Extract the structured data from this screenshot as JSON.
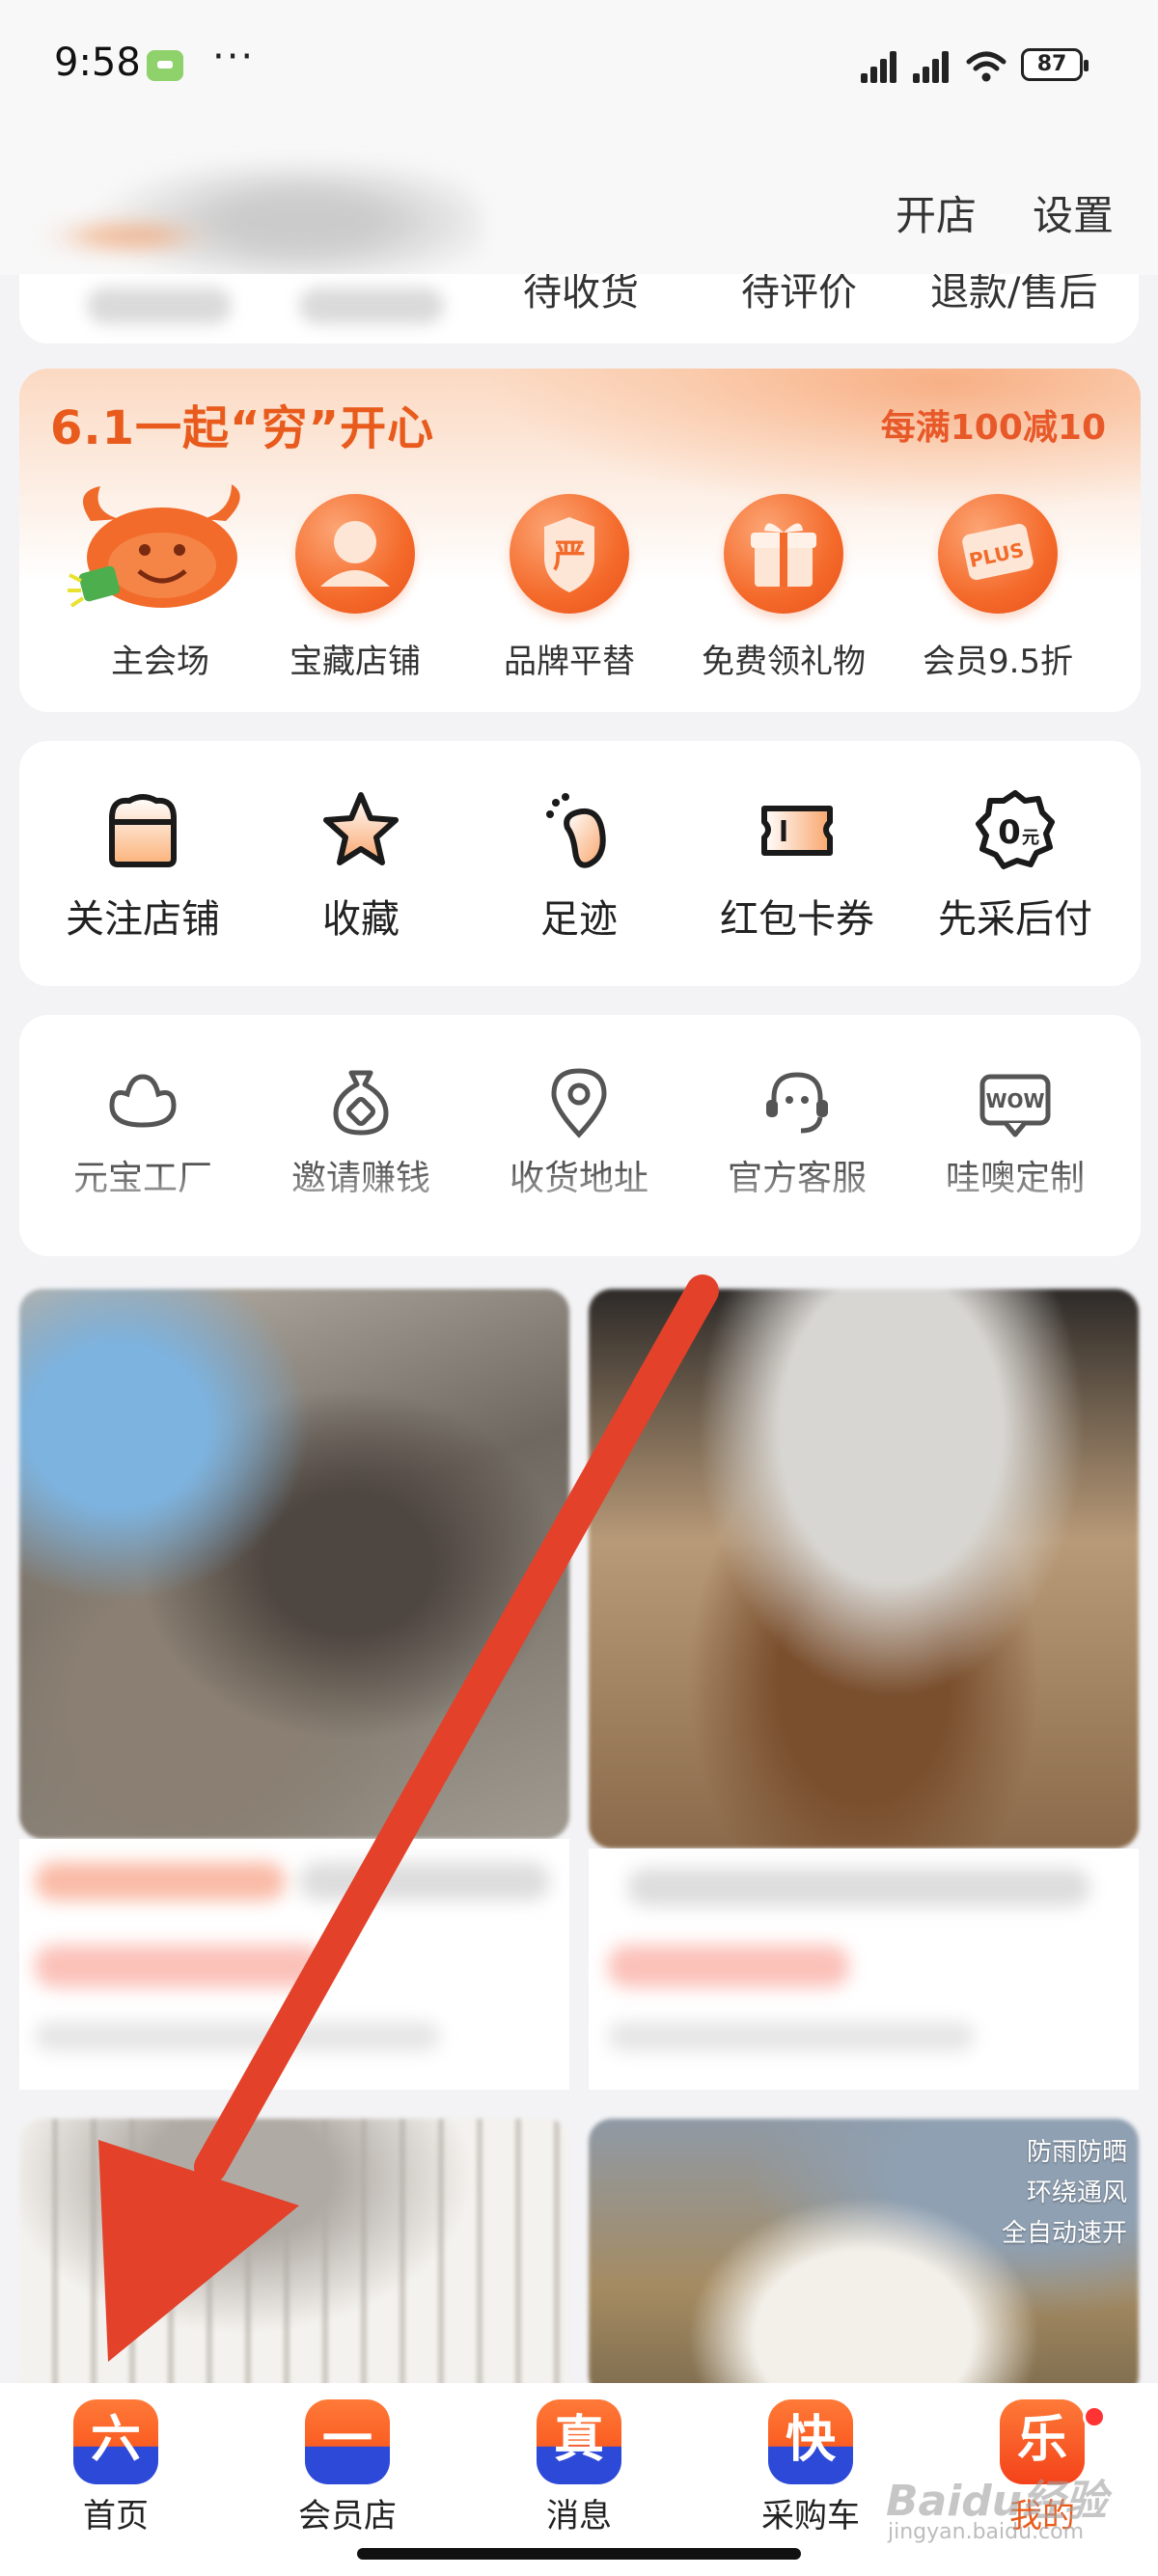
{
  "status_bar": {
    "time": "9:58",
    "battery": "87"
  },
  "header": {
    "open_store": "开店",
    "settings": "设置"
  },
  "orders": {
    "items": [
      "待收货",
      "待评价",
      "退款/售后"
    ]
  },
  "promo": {
    "title": "6.1一起“穷”开心",
    "tag": "每满100减10",
    "items": [
      {
        "label": "主会场",
        "icon": "bull-mascot-icon"
      },
      {
        "label": "宝藏店铺",
        "icon": "person-icon"
      },
      {
        "label": "品牌平替",
        "icon": "yan-shield-icon"
      },
      {
        "label": "免费领礼物",
        "icon": "gift-icon"
      },
      {
        "label": "会员9.5折",
        "icon": "plus-card-icon"
      }
    ]
  },
  "tools": {
    "items": [
      {
        "label": "关注店铺",
        "icon": "store-icon"
      },
      {
        "label": "收藏",
        "icon": "star-icon"
      },
      {
        "label": "足迹",
        "icon": "footprint-icon"
      },
      {
        "label": "红包卡券",
        "icon": "coupon-icon"
      },
      {
        "label": "先采后付",
        "icon": "zero-yuan-icon"
      }
    ]
  },
  "services": {
    "items": [
      {
        "label": "元宝工厂",
        "icon": "ingot-icon"
      },
      {
        "label": "邀请赚钱",
        "icon": "money-bag-icon"
      },
      {
        "label": "收货地址",
        "icon": "location-icon"
      },
      {
        "label": "官方客服",
        "icon": "headset-icon"
      },
      {
        "label": "哇噢定制",
        "icon": "wow-icon"
      }
    ]
  },
  "feed": {
    "tent_lines": [
      "防雨防晒",
      "环绕通风",
      "全自动速开"
    ]
  },
  "tab_bar": {
    "items": [
      {
        "glyph": "六",
        "label": "首页"
      },
      {
        "glyph": "一",
        "label": "会员店"
      },
      {
        "glyph": "真",
        "label": "消息"
      },
      {
        "glyph": "快",
        "label": "采购车"
      },
      {
        "glyph": "乐",
        "label": "我的"
      }
    ]
  },
  "watermark": {
    "main": "Baidu经验",
    "sub": "jingyan.baidu.com"
  },
  "colors": {
    "accent": "#e85b1c",
    "promo_bg": "#fbd9c2",
    "arrow": "#e3412a",
    "tab_blue": "#2d49d8"
  }
}
